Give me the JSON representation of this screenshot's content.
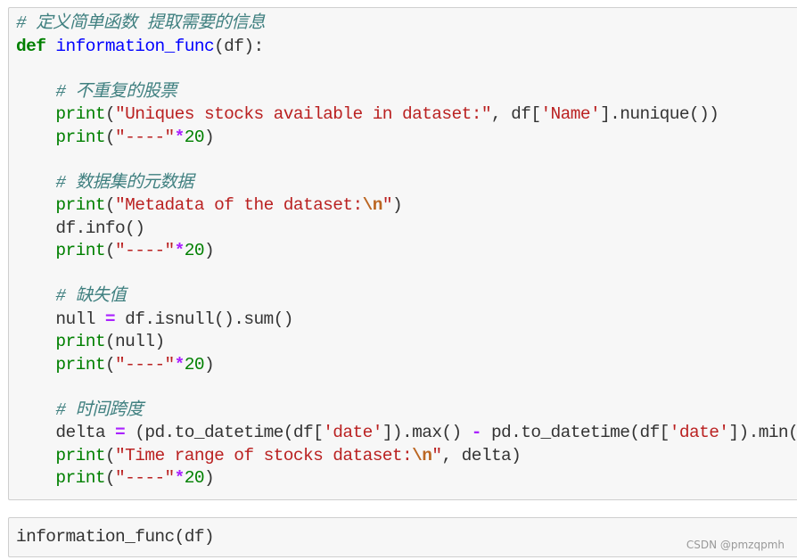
{
  "cell_main": {
    "lines": [
      {
        "tokens": [
          {
            "t": "cm",
            "v": "# 定义简单函数 提取需要的信息"
          }
        ]
      },
      {
        "tokens": [
          {
            "t": "kw",
            "v": "def"
          },
          {
            "t": "tx",
            "v": " "
          },
          {
            "t": "fn",
            "v": "information_func"
          },
          {
            "t": "tx",
            "v": "(df):"
          }
        ]
      },
      {
        "tokens": []
      },
      {
        "tokens": [
          {
            "t": "tx",
            "v": "    "
          },
          {
            "t": "cm",
            "v": "# 不重复的股票"
          }
        ]
      },
      {
        "tokens": [
          {
            "t": "tx",
            "v": "    "
          },
          {
            "t": "bi",
            "v": "print"
          },
          {
            "t": "tx",
            "v": "("
          },
          {
            "t": "st",
            "v": "\"Uniques stocks available in dataset:\""
          },
          {
            "t": "tx",
            "v": ", df["
          },
          {
            "t": "st",
            "v": "'Name'"
          },
          {
            "t": "tx",
            "v": "].nunique())"
          }
        ]
      },
      {
        "tokens": [
          {
            "t": "tx",
            "v": "    "
          },
          {
            "t": "bi",
            "v": "print"
          },
          {
            "t": "tx",
            "v": "("
          },
          {
            "t": "st",
            "v": "\"----\""
          },
          {
            "t": "op",
            "v": "*"
          },
          {
            "t": "nm",
            "v": "20"
          },
          {
            "t": "tx",
            "v": ")"
          }
        ]
      },
      {
        "tokens": []
      },
      {
        "tokens": [
          {
            "t": "tx",
            "v": "    "
          },
          {
            "t": "cm",
            "v": "# 数据集的元数据"
          }
        ]
      },
      {
        "tokens": [
          {
            "t": "tx",
            "v": "    "
          },
          {
            "t": "bi",
            "v": "print"
          },
          {
            "t": "tx",
            "v": "("
          },
          {
            "t": "st",
            "v": "\"Metadata of the dataset:"
          },
          {
            "t": "esc",
            "v": "\\n"
          },
          {
            "t": "st",
            "v": "\""
          },
          {
            "t": "tx",
            "v": ")"
          }
        ]
      },
      {
        "tokens": [
          {
            "t": "tx",
            "v": "    df.info()"
          }
        ]
      },
      {
        "tokens": [
          {
            "t": "tx",
            "v": "    "
          },
          {
            "t": "bi",
            "v": "print"
          },
          {
            "t": "tx",
            "v": "("
          },
          {
            "t": "st",
            "v": "\"----\""
          },
          {
            "t": "op",
            "v": "*"
          },
          {
            "t": "nm",
            "v": "20"
          },
          {
            "t": "tx",
            "v": ")"
          }
        ]
      },
      {
        "tokens": []
      },
      {
        "tokens": [
          {
            "t": "tx",
            "v": "    "
          },
          {
            "t": "cm",
            "v": "# 缺失值"
          }
        ]
      },
      {
        "tokens": [
          {
            "t": "tx",
            "v": "    null "
          },
          {
            "t": "op",
            "v": "="
          },
          {
            "t": "tx",
            "v": " df.isnull().sum()"
          }
        ]
      },
      {
        "tokens": [
          {
            "t": "tx",
            "v": "    "
          },
          {
            "t": "bi",
            "v": "print"
          },
          {
            "t": "tx",
            "v": "(null)"
          }
        ]
      },
      {
        "tokens": [
          {
            "t": "tx",
            "v": "    "
          },
          {
            "t": "bi",
            "v": "print"
          },
          {
            "t": "tx",
            "v": "("
          },
          {
            "t": "st",
            "v": "\"----\""
          },
          {
            "t": "op",
            "v": "*"
          },
          {
            "t": "nm",
            "v": "20"
          },
          {
            "t": "tx",
            "v": ")"
          }
        ]
      },
      {
        "tokens": []
      },
      {
        "tokens": [
          {
            "t": "tx",
            "v": "    "
          },
          {
            "t": "cm",
            "v": "# 时间跨度"
          }
        ]
      },
      {
        "tokens": [
          {
            "t": "tx",
            "v": "    delta "
          },
          {
            "t": "op",
            "v": "="
          },
          {
            "t": "tx",
            "v": " (pd.to_datetime(df["
          },
          {
            "t": "st",
            "v": "'date'"
          },
          {
            "t": "tx",
            "v": "]).max() "
          },
          {
            "t": "op",
            "v": "-"
          },
          {
            "t": "tx",
            "v": " pd.to_datetime(df["
          },
          {
            "t": "st",
            "v": "'date'"
          },
          {
            "t": "tx",
            "v": "]).min())"
          }
        ]
      },
      {
        "tokens": [
          {
            "t": "tx",
            "v": "    "
          },
          {
            "t": "bi",
            "v": "print"
          },
          {
            "t": "tx",
            "v": "("
          },
          {
            "t": "st",
            "v": "\"Time range of stocks dataset:"
          },
          {
            "t": "esc",
            "v": "\\n"
          },
          {
            "t": "st",
            "v": "\""
          },
          {
            "t": "tx",
            "v": ", delta)"
          }
        ]
      },
      {
        "tokens": [
          {
            "t": "tx",
            "v": "    "
          },
          {
            "t": "bi",
            "v": "print"
          },
          {
            "t": "tx",
            "v": "("
          },
          {
            "t": "st",
            "v": "\"----\""
          },
          {
            "t": "op",
            "v": "*"
          },
          {
            "t": "nm",
            "v": "20"
          },
          {
            "t": "tx",
            "v": ")"
          }
        ]
      }
    ]
  },
  "cell_call": {
    "code": "information_func(df)"
  },
  "watermark": "CSDN @pmzqpmh"
}
